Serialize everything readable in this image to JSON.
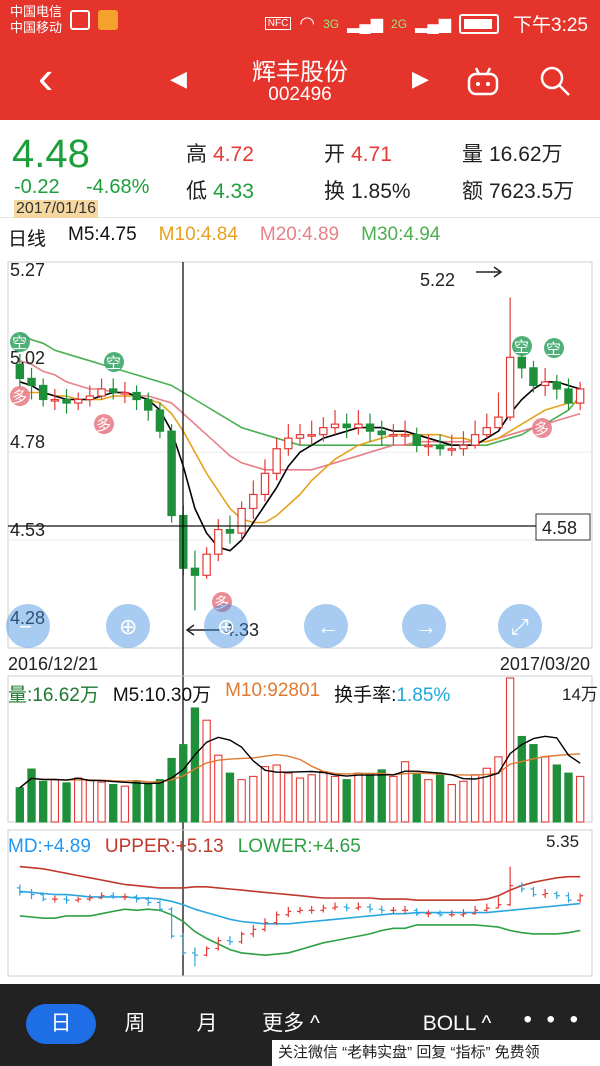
{
  "status_bar": {
    "carrier1": "中国电信",
    "carrier2": "中国移动",
    "signal1": "3G",
    "signal2": "2G",
    "signal3": "2G",
    "nfc": "NFC",
    "time": "下午3:25"
  },
  "nav": {
    "stock_name": "辉丰股份",
    "stock_code": "002496",
    "back_icon": "back-arrow-icon",
    "prev_icon": "triangle-left-icon",
    "next_icon": "triangle-right-icon",
    "robot_icon": "robot-icon",
    "search_icon": "search-icon"
  },
  "quote": {
    "price": "4.48",
    "change": "-0.22",
    "change_pct": "-4.68%",
    "date": "2017/01/16",
    "high_label": "高",
    "high": "4.72",
    "low_label": "低",
    "low": "4.33",
    "open_label": "开",
    "open": "4.71",
    "turnover_label": "换",
    "turnover": "1.85%",
    "volume_label": "量",
    "volume": "16.62万",
    "amount_label": "额",
    "amount": "7623.5万"
  },
  "ma_legend": {
    "period": "日线",
    "m5": "M5:4.75",
    "m10": "M10:4.84",
    "m20": "M20:4.89",
    "m30": "M30:4.94",
    "colors": {
      "m5": "#000000",
      "m10": "#e6a11e",
      "m20": "#e8808a",
      "m30": "#4caf50"
    }
  },
  "kline": {
    "y_labels": [
      "5.27",
      "5.02",
      "4.78",
      "4.53",
      "4.28"
    ],
    "high_marker": "5.22",
    "low_marker": "4.33",
    "crosshair_price": "4.58",
    "start_date": "2016/12/21",
    "end_date": "2017/03/20",
    "buy_signal": "多",
    "sell_signal": "空"
  },
  "volume": {
    "volume_label": "量:16.62万",
    "m5": "M5:10.30万",
    "m10": "M10:92801",
    "turnover_label": "换手率:",
    "turnover": "1.85%",
    "max_label": "14万"
  },
  "boll": {
    "md": "MD:+4.89",
    "upper": "UPPER:+5.13",
    "lower": "LOWER:+4.65",
    "max_label": "5.35"
  },
  "tabs": {
    "day": "日",
    "week": "周",
    "month": "月",
    "more": "更多 ^",
    "indicator": "BOLL ^",
    "dots": "• • •"
  },
  "watermark": "关注微信 “老韩实盘” 回复 “指标” 免费领",
  "chart_data": {
    "type": "candlestick",
    "x_range": [
      "2016/12/21",
      "2017/03/20"
    ],
    "ylim": [
      4.28,
      5.27
    ],
    "opens": [
      5.03,
      4.99,
      4.97,
      4.93,
      4.93,
      4.92,
      4.93,
      4.94,
      4.96,
      4.95,
      4.95,
      4.93,
      4.9,
      4.84,
      4.6,
      4.45,
      4.43,
      4.49,
      4.56,
      4.55,
      4.62,
      4.66,
      4.72,
      4.79,
      4.82,
      4.83,
      4.83,
      4.85,
      4.86,
      4.85,
      4.86,
      4.84,
      4.83,
      4.83,
      4.83,
      4.8,
      4.8,
      4.79,
      4.79,
      4.8,
      4.83,
      4.85,
      4.88,
      5.05,
      5.02,
      4.97,
      4.98,
      4.96,
      4.92
    ],
    "closes": [
      4.99,
      4.97,
      4.93,
      4.93,
      4.92,
      4.93,
      4.94,
      4.96,
      4.95,
      4.95,
      4.93,
      4.9,
      4.84,
      4.6,
      4.45,
      4.43,
      4.49,
      4.56,
      4.55,
      4.62,
      4.66,
      4.72,
      4.79,
      4.82,
      4.83,
      4.83,
      4.85,
      4.86,
      4.85,
      4.86,
      4.84,
      4.83,
      4.83,
      4.83,
      4.8,
      4.8,
      4.79,
      4.79,
      4.8,
      4.83,
      4.85,
      4.88,
      5.05,
      5.02,
      4.97,
      4.98,
      4.96,
      4.92,
      4.96
    ],
    "highs": [
      5.06,
      5.02,
      4.99,
      4.96,
      4.96,
      4.95,
      4.97,
      4.99,
      4.99,
      4.98,
      4.97,
      4.95,
      4.92,
      4.86,
      4.63,
      4.5,
      4.51,
      4.59,
      4.6,
      4.64,
      4.7,
      4.76,
      4.82,
      4.86,
      4.86,
      4.87,
      4.88,
      4.9,
      4.89,
      4.9,
      4.89,
      4.87,
      4.86,
      4.87,
      4.85,
      4.83,
      4.83,
      4.83,
      4.84,
      4.87,
      4.89,
      4.95,
      5.22,
      5.08,
      5.04,
      5.02,
      5.0,
      4.99,
      4.98
    ],
    "lows": [
      4.96,
      4.93,
      4.91,
      4.9,
      4.89,
      4.9,
      4.91,
      4.93,
      4.93,
      4.92,
      4.9,
      4.87,
      4.82,
      4.58,
      4.43,
      4.33,
      4.42,
      4.47,
      4.52,
      4.53,
      4.59,
      4.64,
      4.7,
      4.77,
      4.8,
      4.8,
      4.81,
      4.83,
      4.82,
      4.83,
      4.81,
      4.8,
      4.8,
      4.8,
      4.78,
      4.77,
      4.77,
      4.77,
      4.77,
      4.79,
      4.82,
      4.85,
      4.87,
      4.99,
      4.95,
      4.94,
      4.93,
      4.9,
      4.9
    ],
    "volumes": [
      4.2,
      6.5,
      5.0,
      5.2,
      4.8,
      5.4,
      5.1,
      4.9,
      4.6,
      4.4,
      5.0,
      4.7,
      5.2,
      7.8,
      9.5,
      14.0,
      12.5,
      8.2,
      6.0,
      5.2,
      5.6,
      6.8,
      7.0,
      6.0,
      5.4,
      5.8,
      6.2,
      5.6,
      5.2,
      6.0,
      5.8,
      6.4,
      5.6,
      7.4,
      6.0,
      5.2,
      5.8,
      4.6,
      5.0,
      5.8,
      6.6,
      8.0,
      16.62,
      10.5,
      9.5,
      8.0,
      7.0,
      6.0,
      5.6
    ],
    "ma5": [
      4.98,
      4.97,
      4.95,
      4.94,
      4.93,
      4.93,
      4.93,
      4.94,
      4.95,
      4.95,
      4.94,
      4.93,
      4.9,
      4.84,
      4.74,
      4.62,
      4.55,
      4.51,
      4.5,
      4.53,
      4.58,
      4.63,
      4.68,
      4.74,
      4.78,
      4.8,
      4.82,
      4.83,
      4.84,
      4.85,
      4.85,
      4.85,
      4.84,
      4.84,
      4.83,
      4.82,
      4.81,
      4.8,
      4.8,
      4.8,
      4.82,
      4.84,
      4.89,
      4.93,
      4.96,
      4.98,
      4.98,
      4.97,
      4.96
    ],
    "ma10": [
      4.95,
      4.95,
      4.95,
      4.94,
      4.94,
      4.93,
      4.93,
      4.93,
      4.94,
      4.94,
      4.94,
      4.93,
      4.92,
      4.89,
      4.84,
      4.78,
      4.72,
      4.67,
      4.62,
      4.59,
      4.58,
      4.58,
      4.6,
      4.63,
      4.66,
      4.7,
      4.73,
      4.76,
      4.78,
      4.8,
      4.81,
      4.82,
      4.83,
      4.83,
      4.83,
      4.83,
      4.83,
      4.82,
      4.82,
      4.81,
      4.81,
      4.82,
      4.84,
      4.86,
      4.88,
      4.9,
      4.91,
      4.92,
      4.92
    ],
    "ma20": [
      5.04,
      5.03,
      5.01,
      5.0,
      4.98,
      4.97,
      4.96,
      4.96,
      4.95,
      4.95,
      4.94,
      4.94,
      4.93,
      4.92,
      4.89,
      4.86,
      4.83,
      4.8,
      4.77,
      4.75,
      4.74,
      4.73,
      4.73,
      4.73,
      4.73,
      4.73,
      4.74,
      4.75,
      4.76,
      4.77,
      4.78,
      4.79,
      4.8,
      4.8,
      4.81,
      4.81,
      4.81,
      4.81,
      4.81,
      4.81,
      4.81,
      4.82,
      4.83,
      4.84,
      4.85,
      4.86,
      4.87,
      4.88,
      4.89
    ],
    "ma30": [
      5.12,
      5.1,
      5.09,
      5.07,
      5.06,
      5.05,
      5.04,
      5.03,
      5.02,
      5.01,
      5.0,
      4.99,
      4.98,
      4.97,
      4.95,
      4.93,
      4.91,
      4.89,
      4.87,
      4.85,
      4.84,
      4.83,
      4.82,
      4.81,
      4.8,
      4.8,
      4.8,
      4.8,
      4.8,
      4.8,
      4.8,
      4.8,
      4.8,
      4.8,
      4.8,
      4.8,
      4.8,
      4.8,
      4.8,
      4.8,
      4.8,
      4.81,
      4.82,
      4.83,
      4.85,
      4.86,
      4.88,
      4.9,
      4.94
    ],
    "boll_upper": [
      5.22,
      5.21,
      5.2,
      5.18,
      5.16,
      5.14,
      5.12,
      5.1,
      5.08,
      5.06,
      5.05,
      5.04,
      5.03,
      5.03,
      5.03,
      5.04,
      5.04,
      5.03,
      5.02,
      5.01,
      5.0,
      4.99,
      4.98,
      4.97,
      4.96,
      4.95,
      4.94,
      4.94,
      4.94,
      4.94,
      4.94,
      4.93,
      4.93,
      4.93,
      4.92,
      4.92,
      4.92,
      4.92,
      4.92,
      4.92,
      4.93,
      4.96,
      5.01,
      5.05,
      5.08,
      5.1,
      5.12,
      5.13,
      5.13
    ],
    "boll_mid": [
      5.0,
      4.99,
      4.98,
      4.97,
      4.97,
      4.96,
      4.95,
      4.95,
      4.95,
      4.95,
      4.94,
      4.94,
      4.93,
      4.91,
      4.88,
      4.84,
      4.81,
      4.78,
      4.75,
      4.73,
      4.72,
      4.71,
      4.71,
      4.71,
      4.72,
      4.73,
      4.74,
      4.75,
      4.76,
      4.77,
      4.78,
      4.79,
      4.8,
      4.8,
      4.81,
      4.81,
      4.81,
      4.81,
      4.81,
      4.81,
      4.81,
      4.82,
      4.83,
      4.84,
      4.85,
      4.86,
      4.87,
      4.88,
      4.89
    ],
    "boll_lower": [
      4.78,
      4.77,
      4.76,
      4.76,
      4.78,
      4.78,
      4.78,
      4.8,
      4.82,
      4.84,
      4.83,
      4.84,
      4.83,
      4.79,
      4.73,
      4.64,
      4.58,
      4.53,
      4.48,
      4.45,
      4.44,
      4.43,
      4.44,
      4.45,
      4.48,
      4.51,
      4.54,
      4.56,
      4.58,
      4.6,
      4.62,
      4.65,
      4.67,
      4.67,
      4.7,
      4.7,
      4.7,
      4.7,
      4.7,
      4.7,
      4.69,
      4.68,
      4.65,
      4.63,
      4.62,
      4.62,
      4.62,
      4.63,
      4.65
    ]
  }
}
